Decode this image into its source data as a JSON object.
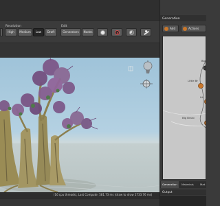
{
  "toolbar": {
    "resolution_label": "Resolution",
    "edit_label": "Edit",
    "resolution_buttons": [
      "High",
      "Medium",
      "Low",
      "Draft"
    ],
    "edit_buttons": [
      "Generators",
      "Nodes"
    ]
  },
  "status": {
    "text": "(16 cpu threads), Last Compute: 581.73 ms (draw to draw 2733.76 ms)"
  },
  "right_panel": {
    "title": "Generation",
    "add_label": "Add",
    "actions_label": "Actions",
    "nodes": [
      "Bas",
      "Little Br",
      "Lit",
      "Big Branc"
    ],
    "tabs": [
      "Generation",
      "Materials",
      "Mat"
    ],
    "output_label": "Output"
  },
  "colors": {
    "sky": "#a9c9dd",
    "ground": "#bcc6c6",
    "foliage": "#8a5f8e",
    "trunk": "#a0935f",
    "node_accent": "#c9772b"
  },
  "icons": [
    "sphere-icon",
    "target-icon",
    "shaded-sphere-icon",
    "lighting-icon",
    "light-bulb-icon",
    "pin-icon"
  ]
}
